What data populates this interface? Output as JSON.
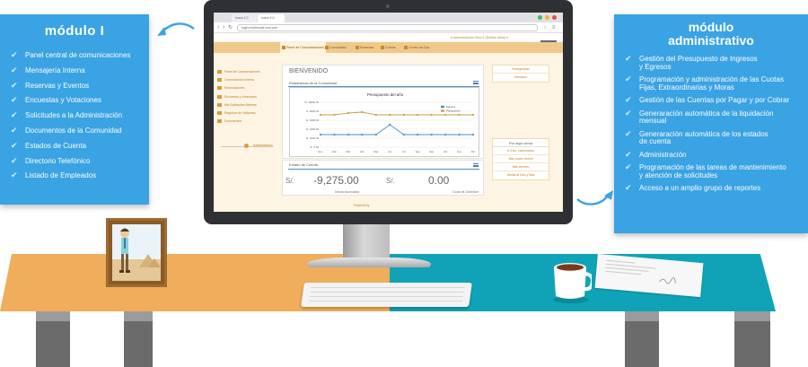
{
  "left_panel": {
    "title": "módulo I",
    "items": [
      "Panel central de comunicaciones",
      "Mensajería Interna",
      "Reservas y Eventos",
      "Encuestas y Votaciones",
      "Solicitudes a la Administración",
      "Documentos de la Comunidad",
      "Estados de Cuenta",
      "Directorio Telefónico",
      "Listado de Empleados"
    ]
  },
  "right_panel": {
    "title_line1": "módulo",
    "title_line2": "administrativo",
    "items": [
      [
        "Gestión del Presupuesto de Ingresos",
        "y Egresos"
      ],
      [
        "Programación y administración de las Cuotas",
        "Fijas, Extraordinarias y Moras"
      ],
      [
        "Gestión de las Cuentas por Pagar y por Cobrar",
        ""
      ],
      [
        "Generaración automática de la liquidación",
        "mensual"
      ],
      [
        "Generaración automática de los estados",
        "de cuenta"
      ],
      [
        "Administración",
        ""
      ],
      [
        "Programación de las tareas de mantenimiento",
        "y atención de solicitudes"
      ],
      [
        "Acceso a un amplio grupo de reportes",
        ""
      ]
    ]
  },
  "screen": {
    "browser": {
      "tabs": [
        "Icono 1.0",
        "Icono 2.0"
      ],
      "url": "login.residencial.com.com"
    },
    "user_menu": "● Administración Mod 1 (Edificio altos) ▾",
    "nav": [
      "Panel de Comunicaciones",
      "Comunidad",
      "Reservas",
      "Cobros",
      "Centro de Ops"
    ],
    "sidebar": [
      "Panel de Comunicaciones",
      "Comunicación Interna",
      "Reservaciones",
      "Encuestas y Votaciones",
      "Mis Solicitudes Abiertas",
      "Registros de Visitantes",
      "Documentos"
    ],
    "slider_label": "Administración",
    "page_title": "BIENVENIDO",
    "stats_heading": "Estadísticas de la Comunidad",
    "state_heading": "Estado de Cuenta",
    "currency": "S/.",
    "balance_due": "-9,275.00",
    "balance_due_caption": "Deuda Acumulada",
    "balance_credit": "0.00",
    "balance_credit_caption": "Cuota de Diciembre",
    "footer": "Powered by",
    "right_buttons": [
      "Emergencias",
      "Directorio"
    ],
    "right_list_heading": "Por aquí cerca",
    "right_list": [
      "A 3 km, comunicado",
      "Más cuarto común",
      "Más cercano",
      "Ventas al Ocio y Más"
    ]
  },
  "chart_data": {
    "type": "line",
    "title": "Presupuesto del año",
    "categories": [
      "Ene",
      "Feb",
      "Mar",
      "Abr",
      "May",
      "Jun",
      "Jul",
      "Ago",
      "Sep",
      "Oct",
      "Nov",
      "Dic"
    ],
    "y_ticks": [
      "S/. 10000.00",
      "S/. 8000.00",
      "S/. 6000.00",
      "S/. 4000.00",
      "S/. 2000.00",
      "S/. 0.00"
    ],
    "ylim": [
      0,
      10000
    ],
    "grid": true,
    "legend_position": "top-right",
    "series": [
      {
        "name": "Egresos",
        "color": "#4a8fc7",
        "values": [
          2800,
          2800,
          2800,
          2800,
          2800,
          5000,
          2800,
          2800,
          2800,
          2800,
          2800,
          2800
        ]
      },
      {
        "name": "Presupuesto",
        "color": "#c8a041",
        "values": [
          7200,
          7200,
          7600,
          7800,
          7200,
          7200,
          7200,
          7200,
          7200,
          7200,
          7200,
          7200
        ]
      }
    ]
  },
  "colors": {
    "panel_blue": "#3aa3e3",
    "desk_orange": "#f0ad5b",
    "desk_teal": "#10a3b7",
    "app_accent": "#f0c98a"
  }
}
